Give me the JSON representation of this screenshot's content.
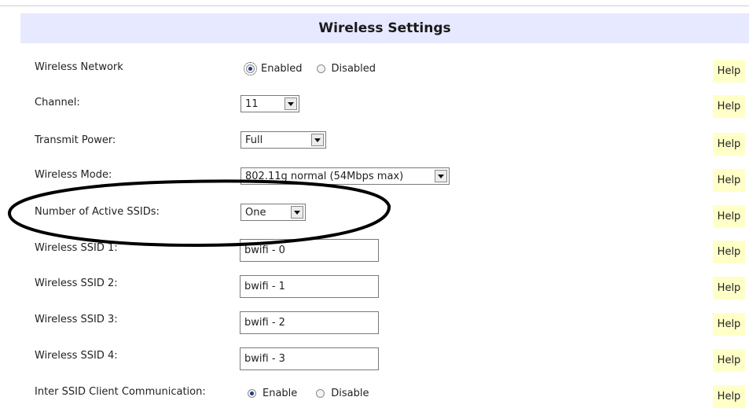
{
  "header": {
    "title": "Wireless Settings"
  },
  "help_label": "Help",
  "rows": {
    "wireless_network": {
      "label": "Wireless Network",
      "option_enabled": "Enabled",
      "option_disabled": "Disabled",
      "selected": "Enabled"
    },
    "channel": {
      "label": "Channel:",
      "value": "11"
    },
    "transmit_power": {
      "label": "Transmit Power:",
      "value": "Full"
    },
    "wireless_mode": {
      "label": "Wireless Mode:",
      "value": "802.11g normal (54Mbps max)"
    },
    "active_ssids": {
      "label": "Number of Active SSIDs:",
      "value": "One"
    },
    "ssid1": {
      "label": "Wireless SSID 1:",
      "value": "bwifi - 0"
    },
    "ssid2": {
      "label": "Wireless SSID 2:",
      "value": "bwifi - 1"
    },
    "ssid3": {
      "label": "Wireless SSID 3:",
      "value": "bwifi - 2"
    },
    "ssid4": {
      "label": "Wireless SSID 4:",
      "value": "bwifi - 3"
    },
    "inter_ssid": {
      "label": "Inter SSID Client Communication:",
      "option_enable": "Enable",
      "option_disable": "Disable",
      "selected": "Enable"
    }
  },
  "colors": {
    "header_bg": "#e6e9ff",
    "help_bg": "#ffffc8",
    "radio_dot": "#1f3a8a"
  }
}
